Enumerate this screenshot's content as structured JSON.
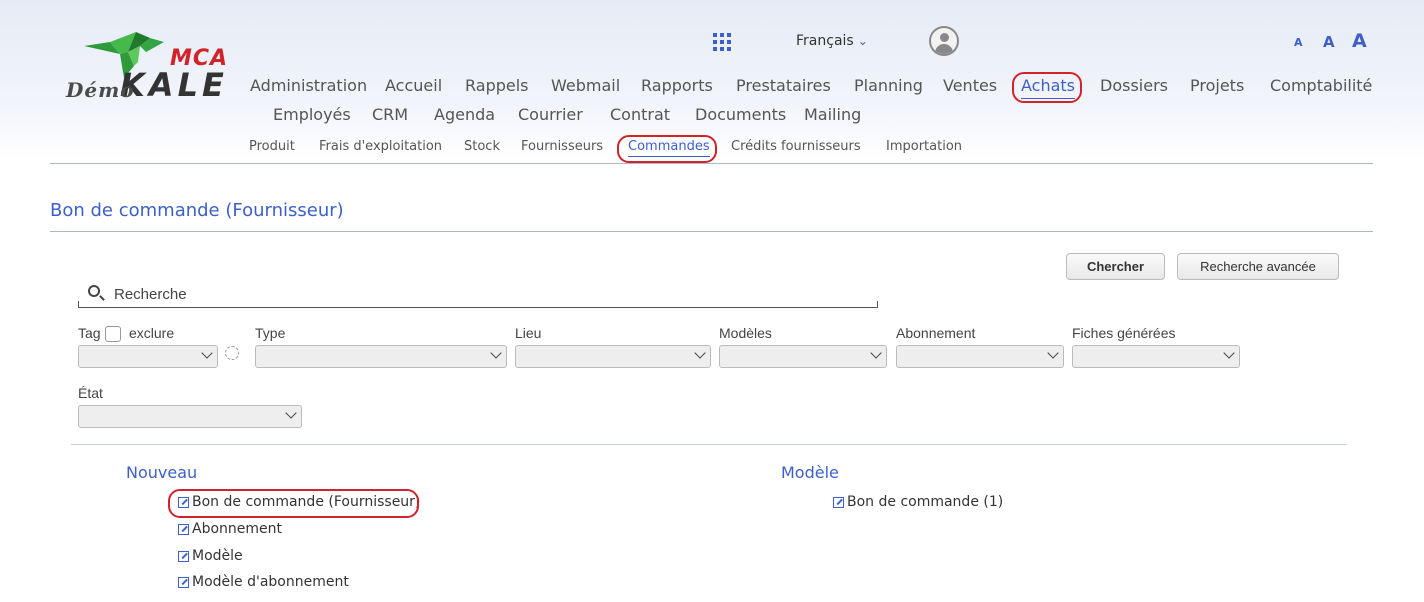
{
  "logo": {
    "demo": "Démo",
    "mca": "MCA",
    "kale": "KALE"
  },
  "header": {
    "language": "Français",
    "font_sizes": [
      "A",
      "A",
      "A"
    ]
  },
  "main_nav": {
    "row1": [
      "Administration",
      "Accueil",
      "Rappels",
      "Webmail",
      "Rapports",
      "Prestataires",
      "Planning",
      "Ventes",
      "Achats",
      "Dossiers",
      "Projets",
      "Comptabilité"
    ],
    "row2": [
      "Employés",
      "CRM",
      "Agenda",
      "Courrier",
      "Contrat",
      "Documents",
      "Mailing"
    ],
    "active": "Achats"
  },
  "sub_nav": {
    "items": [
      "Produit",
      "Frais d'exploitation",
      "Stock",
      "Fournisseurs",
      "Commandes",
      "Crédits fournisseurs",
      "Importation"
    ],
    "active": "Commandes"
  },
  "page": {
    "title": "Bon de commande (Fournisseur)"
  },
  "search": {
    "placeholder": "Recherche",
    "search_button": "Chercher",
    "advanced_button": "Recherche avancée"
  },
  "filters": {
    "tag": "Tag",
    "exclude": "exclure",
    "type": "Type",
    "lieu": "Lieu",
    "modeles": "Modèles",
    "abonnement": "Abonnement",
    "fiches": "Fiches générées",
    "etat": "État"
  },
  "nouveau": {
    "title": "Nouveau",
    "items": [
      "Bon de commande (Fournisseur)",
      "Abonnement",
      "Modèle",
      "Modèle d'abonnement"
    ]
  },
  "modele": {
    "title": "Modèle",
    "items": [
      "Bon de commande (1)"
    ]
  }
}
